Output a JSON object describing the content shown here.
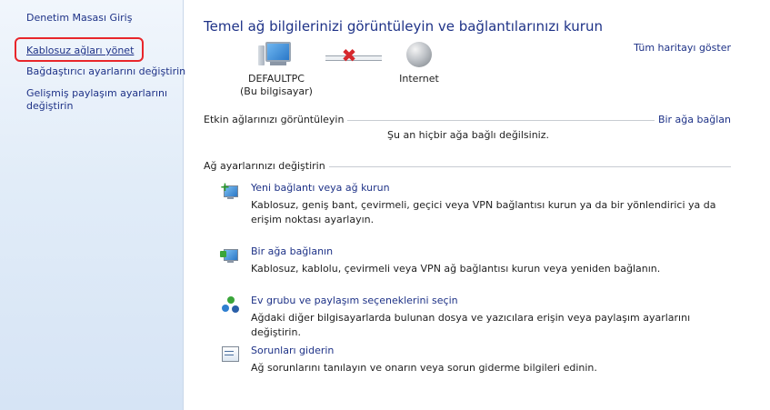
{
  "sidebar": {
    "home": "Denetim Masası Giriş",
    "items": [
      {
        "label": "Kablosuz ağları yönet"
      },
      {
        "label": "Bağdaştırıcı ayarlarını değiştirin"
      },
      {
        "label": "Gelişmiş paylaşım ayarlarını değiştirin"
      }
    ],
    "highlight_color": "#e8262b"
  },
  "main": {
    "title": "Temel ağ bilgilerinizi görüntüleyin ve bağlantılarınızı kurun",
    "full_map_link": "Tüm haritayı göster",
    "map": {
      "computer_name": "DEFAULTPC",
      "computer_subtitle": "(Bu bilgisayar)",
      "internet_label": "Internet",
      "connection_status_icon": "red-x-icon"
    },
    "active_networks": {
      "heading": "Etkin ağlarınızı görüntüleyin",
      "connect_link": "Bir ağa bağlan",
      "status": "Şu an hiçbir ağa bağlı değilsiniz."
    },
    "settings": {
      "heading": "Ağ ayarlarınızı değiştirin",
      "tasks": [
        {
          "title": "Yeni bağlantı veya ağ kurun",
          "description": "Kablosuz, geniş bant, çevirmeli, geçici veya VPN bağlantısı kurun ya da bir yönlendirici ya da erişim noktası ayarlayın.",
          "icon": "new-connection-icon"
        },
        {
          "title": "Bir ağa bağlanın",
          "description": "Kablosuz, kablolu, çevirmeli veya VPN ağ bağlantısı kurun veya yeniden bağlanın.",
          "icon": "connect-network-icon"
        },
        {
          "title": "Ev grubu ve paylaşım seçeneklerini seçin",
          "description": "Ağdaki diğer bilgisayarlarda bulunan dosya ve yazıcılara erişin veya paylaşım ayarlarını değiştirin.",
          "icon": "homegroup-icon"
        },
        {
          "title": "Sorunları giderin",
          "description": "Ağ sorunlarını tanılayın ve onarın veya sorun giderme bilgileri edinin.",
          "icon": "troubleshoot-icon"
        }
      ]
    }
  },
  "colors": {
    "link": "#1e3287",
    "sidebar_bg": "#e1ecf8",
    "error_x": "#d6282d"
  }
}
